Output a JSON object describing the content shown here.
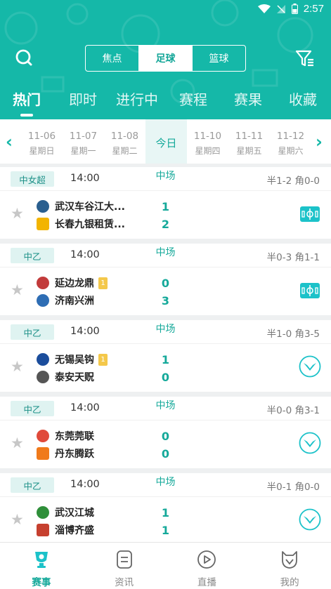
{
  "status_bar": {
    "time": "2:57"
  },
  "segment": [
    {
      "label": "焦点",
      "active": false
    },
    {
      "label": "足球",
      "active": true
    },
    {
      "label": "篮球",
      "active": false
    }
  ],
  "tabs": [
    {
      "label": "热门",
      "active": true
    },
    {
      "label": "即时",
      "active": false
    },
    {
      "label": "进行中",
      "active": false
    },
    {
      "label": "赛程",
      "active": false
    },
    {
      "label": "赛果",
      "active": false
    },
    {
      "label": "收藏",
      "active": false
    }
  ],
  "dates": [
    {
      "date": "11-06",
      "week": "星期日"
    },
    {
      "date": "11-07",
      "week": "星期一"
    },
    {
      "date": "11-08",
      "week": "星期二"
    },
    {
      "date": "今日",
      "week": ""
    },
    {
      "date": "11-10",
      "week": "星期四"
    },
    {
      "date": "11-11",
      "week": "星期五"
    },
    {
      "date": "11-12",
      "week": "星期六"
    }
  ],
  "matches": [
    {
      "league": "中女超",
      "time": "14:00",
      "status": "中场",
      "half": "半1-2 角0-0",
      "home": {
        "name": "武汉车谷江大...",
        "score": "1",
        "card": ""
      },
      "away": {
        "name": "长春九银租赁...",
        "score": "2",
        "card": ""
      },
      "icon": "live-video"
    },
    {
      "league": "中乙",
      "time": "14:00",
      "status": "中场",
      "half": "半0-3 角1-1",
      "home": {
        "name": "延边龙鼎",
        "score": "0",
        "card": "1"
      },
      "away": {
        "name": "济南兴洲",
        "score": "3",
        "card": ""
      },
      "icon": "live-video"
    },
    {
      "league": "中乙",
      "time": "14:00",
      "status": "中场",
      "half": "半1-0 角3-5",
      "home": {
        "name": "无锡吴钩",
        "score": "1",
        "card": "1"
      },
      "away": {
        "name": "泰安天贶",
        "score": "0",
        "card": ""
      },
      "icon": "animation"
    },
    {
      "league": "中乙",
      "time": "14:00",
      "status": "中场",
      "half": "半0-0 角3-1",
      "home": {
        "name": "东莞莞联",
        "score": "0",
        "card": ""
      },
      "away": {
        "name": "丹东腾跃",
        "score": "0",
        "card": ""
      },
      "icon": "animation"
    },
    {
      "league": "中乙",
      "time": "14:00",
      "status": "中场",
      "half": "半0-1 角0-0",
      "home": {
        "name": "武汉江城",
        "score": "1",
        "card": ""
      },
      "away": {
        "name": "淄博齐盛",
        "score": "1",
        "card": ""
      },
      "icon": "animation"
    }
  ],
  "bottom_nav": [
    {
      "label": "赛事",
      "active": true
    },
    {
      "label": "资讯",
      "active": false
    },
    {
      "label": "直播",
      "active": false
    },
    {
      "label": "我的",
      "active": false
    }
  ],
  "colors": {
    "accent": "#15b8a8",
    "score": "#15a99a",
    "card": "#f4c84a"
  }
}
